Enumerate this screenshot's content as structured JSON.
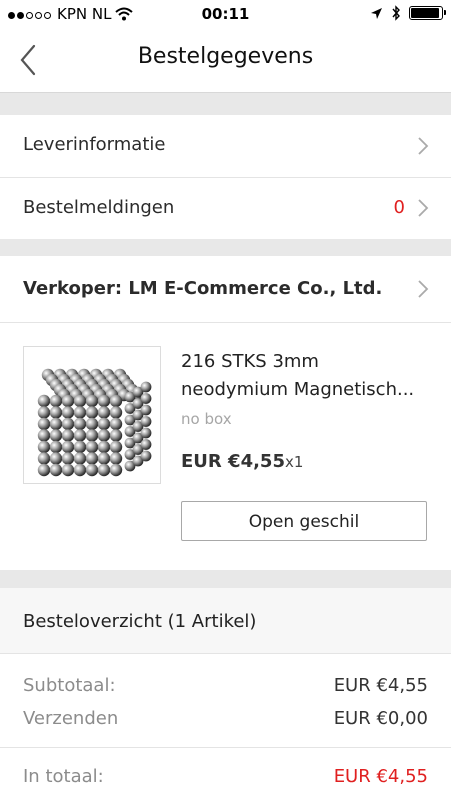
{
  "status_bar": {
    "carrier": "KPN NL",
    "time": "00:11"
  },
  "nav": {
    "title": "Bestelgegevens"
  },
  "info_rows": [
    {
      "label": "Leverinformatie"
    },
    {
      "label": "Bestelmeldingen",
      "count": "0"
    }
  ],
  "seller": {
    "label": "Verkoper: LM E-Commerce Co., Ltd."
  },
  "product": {
    "title_line1": "216 STKS 3mm",
    "title_line2": "neodymium Magnetisch...",
    "sku": "no box",
    "price": "EUR €4,55",
    "qty": "x1",
    "dispute_button": "Open geschil"
  },
  "summary": {
    "title": "Besteloverzicht (1 Artikel)",
    "rows": [
      {
        "label": "Subtotaal:",
        "value": "EUR €4,55"
      },
      {
        "label": "Verzenden",
        "value": "EUR €0,00"
      }
    ],
    "total_label": "In totaal:",
    "total_value": "EUR €4,55"
  },
  "colors": {
    "accent_red": "#e02020",
    "separator": "#e8e8e8"
  }
}
